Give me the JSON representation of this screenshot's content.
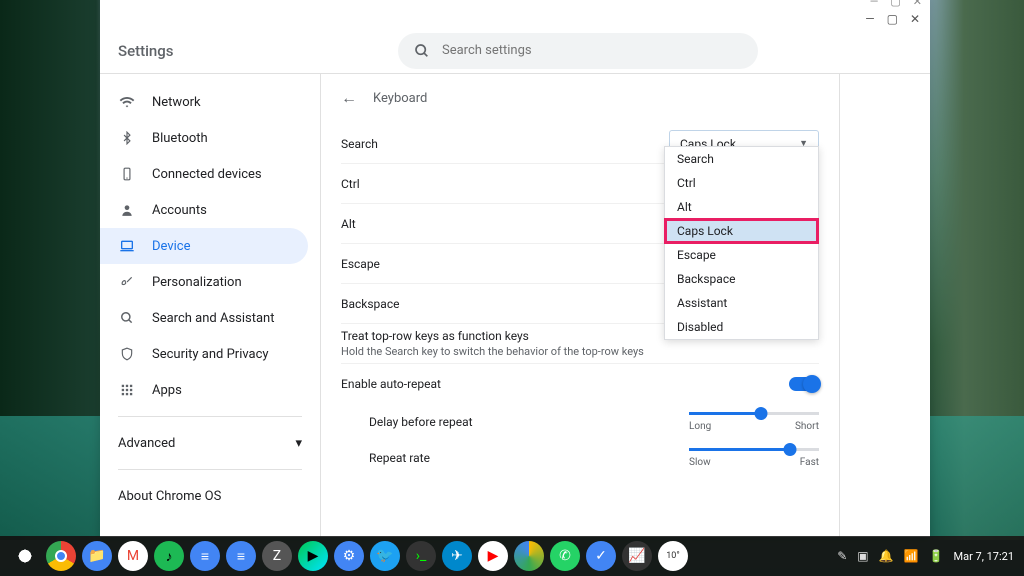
{
  "header": {
    "title": "Settings",
    "search_placeholder": "Search settings"
  },
  "sidebar": {
    "items": [
      {
        "label": "Network",
        "icon": "wifi"
      },
      {
        "label": "Bluetooth",
        "icon": "bluetooth"
      },
      {
        "label": "Connected devices",
        "icon": "phone"
      },
      {
        "label": "Accounts",
        "icon": "person"
      },
      {
        "label": "Device",
        "icon": "laptop"
      },
      {
        "label": "Personalization",
        "icon": "brush"
      },
      {
        "label": "Search and Assistant",
        "icon": "search"
      },
      {
        "label": "Security and Privacy",
        "icon": "shield"
      },
      {
        "label": "Apps",
        "icon": "apps"
      }
    ],
    "advanced": "Advanced",
    "about": "About Chrome OS"
  },
  "panel": {
    "title": "Keyboard",
    "rows": {
      "search": "Search",
      "ctrl": "Ctrl",
      "alt": "Alt",
      "escape": "Escape",
      "backspace": "Backspace",
      "toprow_label": "Treat top-row keys as function keys",
      "toprow_sub": "Hold the Search key to switch the behavior of the top-row keys",
      "autorepeat": "Enable auto-repeat",
      "delay": "Delay before repeat",
      "delay_min": "Long",
      "delay_max": "Short",
      "rate": "Repeat rate",
      "rate_min": "Slow",
      "rate_max": "Fast"
    },
    "dropdown_selected": "Caps Lock",
    "dropdown_options": [
      "Search",
      "Ctrl",
      "Alt",
      "Caps Lock",
      "Escape",
      "Backspace",
      "Assistant",
      "Disabled"
    ]
  },
  "taskbar": {
    "time": "Mar 7, 17:21"
  }
}
